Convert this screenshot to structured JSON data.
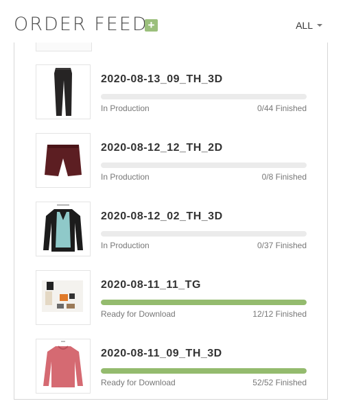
{
  "header": {
    "title": "ORDER FEED",
    "add_symbol": "+",
    "filter_label": "ALL"
  },
  "orders": [
    {
      "name": "2020-08-13_09_TH_3D",
      "status": "In Production",
      "count": "0/44 Finished",
      "progress": 0,
      "thumb": "pants-icon"
    },
    {
      "name": "2020-08-12_12_TH_2D",
      "status": "In Production",
      "count": "0/8 Finished",
      "progress": 0,
      "thumb": "shorts-icon"
    },
    {
      "name": "2020-08-12_02_TH_3D",
      "status": "In Production",
      "count": "0/37 Finished",
      "progress": 0,
      "thumb": "blouse-icon"
    },
    {
      "name": "2020-08-11_11_TG",
      "status": "Ready for Download",
      "count": "12/12 Finished",
      "progress": 1,
      "thumb": "flatlay-icon"
    },
    {
      "name": "2020-08-11_09_TH_3D",
      "status": "Ready for Download",
      "count": "52/52 Finished",
      "progress": 1,
      "thumb": "sweater-icon"
    }
  ],
  "colors": {
    "accent_green": "#94bb6e",
    "track_gray": "#ebebeb"
  }
}
